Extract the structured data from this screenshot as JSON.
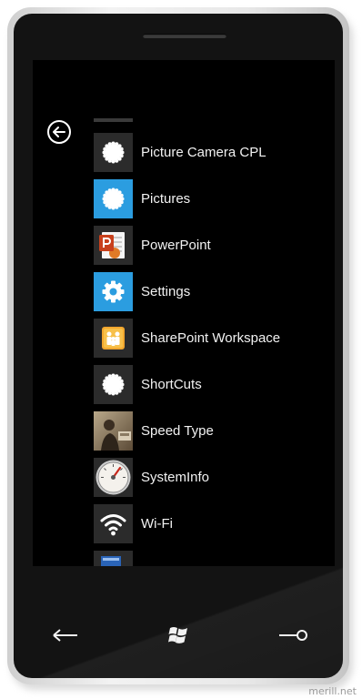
{
  "apps": [
    {
      "label": "Picture Camera CPL",
      "icon": "gear-flower-icon",
      "tile_color": "#2b2b2b"
    },
    {
      "label": "Pictures",
      "icon": "gear-flower-icon",
      "tile_color": "#2b9de0"
    },
    {
      "label": "PowerPoint",
      "icon": "powerpoint-icon",
      "tile_color": "#2b2b2b"
    },
    {
      "label": "Settings",
      "icon": "settings-gear-icon",
      "tile_color": "#2b9de0"
    },
    {
      "label": "SharePoint Workspace",
      "icon": "sharepoint-workspace-icon",
      "tile_color": "#2b2b2b"
    },
    {
      "label": "ShortCuts",
      "icon": "gear-flower-icon",
      "tile_color": "#2b2b2b"
    },
    {
      "label": "Speed Type",
      "icon": "photo-thumbnail-icon",
      "tile_color": "#2b2b2b"
    },
    {
      "label": "SystemInfo",
      "icon": "gauge-icon",
      "tile_color": "#2b2b2b"
    },
    {
      "label": "Wi-Fi",
      "icon": "wifi-icon",
      "tile_color": "#2b2b2b"
    }
  ],
  "hardware_keys": {
    "back": "back-arrow-icon",
    "start": "windows-logo-icon",
    "search": "search-key-icon"
  },
  "watermark": "merill.net",
  "colors": {
    "accent": "#2b9de0",
    "bezel": "#131313",
    "screen": "#000000",
    "text": "#f2f2f2"
  }
}
